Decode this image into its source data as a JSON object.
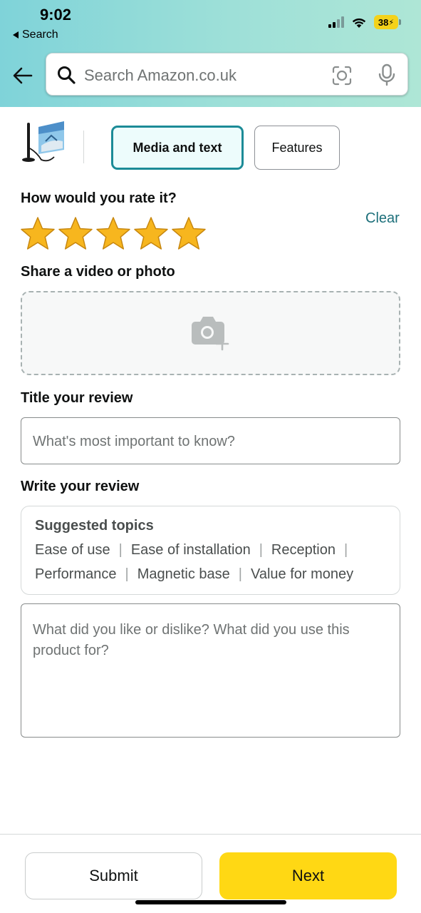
{
  "status_bar": {
    "time": "9:02",
    "back_label": "Search",
    "battery": "38"
  },
  "search": {
    "placeholder": "Search Amazon.co.uk"
  },
  "tabs": {
    "active": "Media and text",
    "inactive": "Features"
  },
  "rating": {
    "label": "How would you rate it?",
    "clear": "Clear",
    "stars": 5,
    "max_stars": 5,
    "star_color": "#f7b61e"
  },
  "media": {
    "label": "Share a video or photo"
  },
  "title_field": {
    "label": "Title your review",
    "placeholder": "What's most important to know?"
  },
  "review_field": {
    "label": "Write your review",
    "suggested_title": "Suggested topics",
    "topics_row1": [
      "Ease of use",
      "Ease of installation",
      "Reception"
    ],
    "topics_row2": [
      "Performance",
      "Magnetic base",
      "Value for money"
    ],
    "placeholder": "What did you like or dislike? What did you use this product for?"
  },
  "footer": {
    "submit": "Submit",
    "next": "Next"
  },
  "colors": {
    "accent_teal": "#1c8b97",
    "link": "#1c6f7a",
    "next_button": "#ffd814"
  }
}
